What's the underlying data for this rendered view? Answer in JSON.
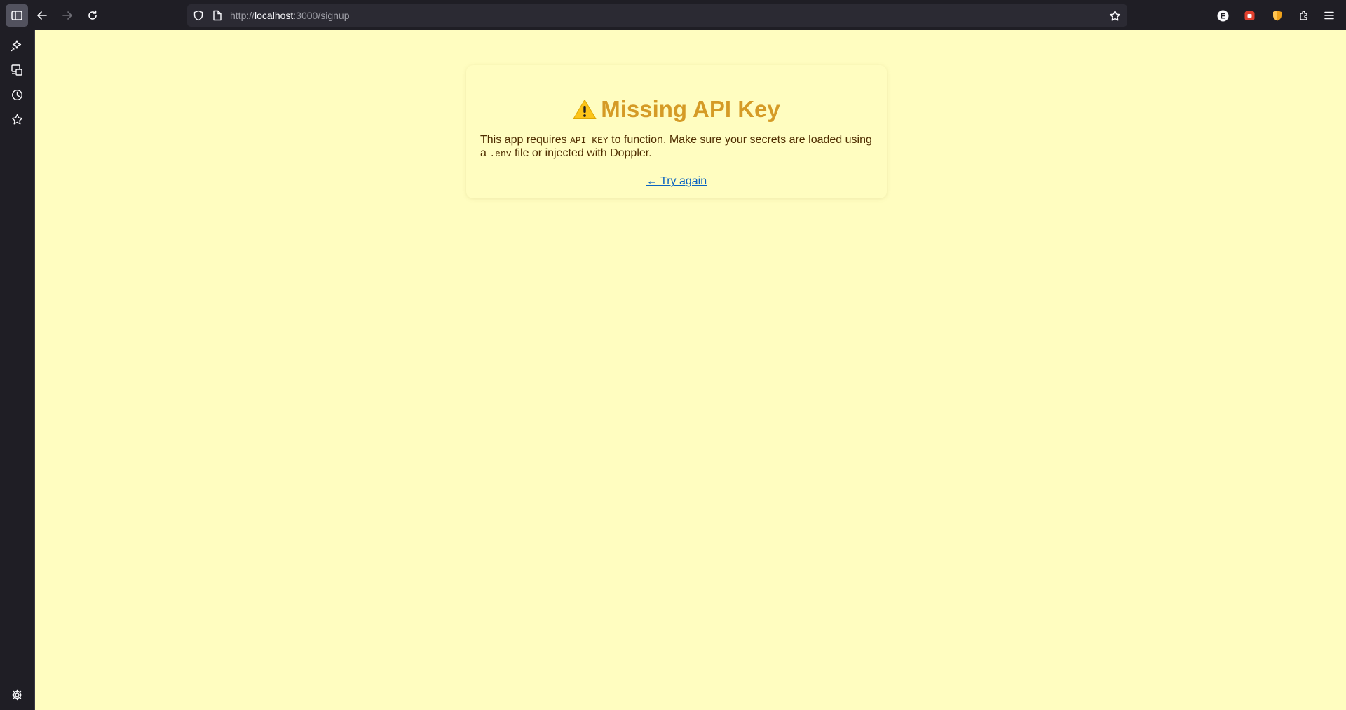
{
  "browser": {
    "url_scheme": "http://",
    "url_host": "localhost",
    "url_rest": ":3000/signup",
    "toolbar_icons": [
      "sidebar-toggle-icon",
      "back-arrow-icon",
      "forward-arrow-icon",
      "reload-icon",
      "shield-icon",
      "page-icon",
      "bookmark-star-icon",
      "extension-e-icon",
      "extension-red-icon",
      "extension-shield-orange-icon",
      "puzzle-icon",
      "menu-icon"
    ],
    "sidebar_icons": [
      "ai-sparkle-icon",
      "synced-tabs-icon",
      "history-clock-icon",
      "bookmarks-star-icon",
      "settings-gear-icon"
    ],
    "extension_e_letter": "E"
  },
  "error": {
    "title": "Missing API Key",
    "message_part1": "This app requires ",
    "code_key": "API_KEY",
    "message_part2": " to function. Make sure your secrets are loaded using a ",
    "code_env": ".env",
    "message_part3": " file or injected with Doppler.",
    "retry_link": "← Try again"
  },
  "colors": {
    "page_background": "#fffdc0",
    "title": "#d59b26",
    "text": "#4f2d00",
    "link": "#0b63c1",
    "chrome": "#1f1e25"
  }
}
